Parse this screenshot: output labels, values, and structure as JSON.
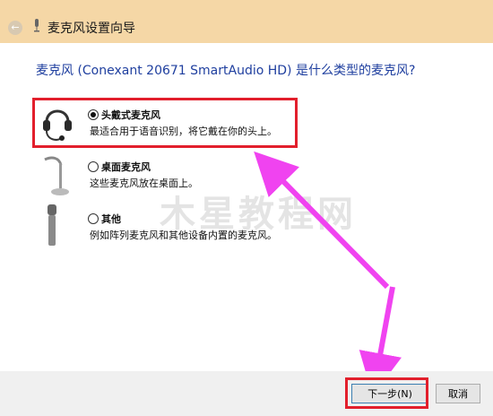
{
  "window": {
    "title": "麦克风设置向导"
  },
  "question": "麦克风 (Conexant 20671 SmartAudio HD) 是什么类型的麦克风?",
  "options": [
    {
      "label": "头戴式麦克风",
      "description": "最适合用于语音识别，将它戴在你的头上。",
      "selected": true,
      "icon": "headset-icon"
    },
    {
      "label": "桌面麦克风",
      "description": "这些麦克风放在桌面上。",
      "selected": false,
      "icon": "desktop-mic-icon"
    },
    {
      "label": "其他",
      "description": "例如阵列麦克风和其他设备内置的麦克风。",
      "selected": false,
      "icon": "handheld-mic-icon"
    }
  ],
  "watermark": "木星教程网",
  "buttons": {
    "next": "下一步(N)",
    "cancel": "取消"
  },
  "colors": {
    "titlebar": "#f5d7a6",
    "question_text": "#1f3f9f",
    "highlight": "#e21f2c",
    "arrow": "#f043f0"
  }
}
